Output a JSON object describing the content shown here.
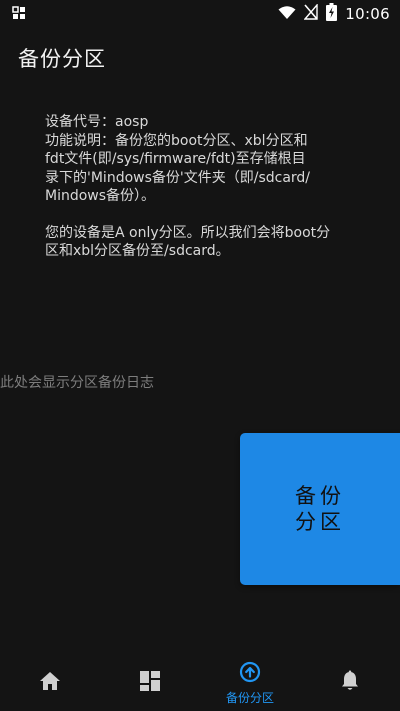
{
  "status_bar": {
    "time": "10:06",
    "icons": [
      "notification-grid-icon",
      "wifi-icon",
      "no-sim-icon",
      "battery-charging-icon"
    ]
  },
  "app_bar": {
    "title": "备份分区"
  },
  "info": {
    "lines": [
      "设备代号：aosp",
      "功能说明：备份您的boot分区、xbl分区和",
      "fdt文件(即/sys/firmware/fdt)至存储根目",
      "录下的'Mindows备份'文件夹（即/sdcard/",
      "Mindows备份）。"
    ],
    "device_lines": [
      "您的设备是A only分区。所以我们会将boot分",
      "区和xbl分区备份至/sdcard。"
    ]
  },
  "log": {
    "placeholder": "此处会显示分区备份日志"
  },
  "actions": {
    "backup_label": "备份分区"
  },
  "bottom_nav": {
    "items": [
      {
        "icon": "home-icon",
        "label": ""
      },
      {
        "icon": "dashboard-icon",
        "label": ""
      },
      {
        "icon": "upload-circle-icon",
        "label": "备份分区",
        "active": true
      },
      {
        "icon": "bell-icon",
        "label": ""
      }
    ]
  },
  "colors": {
    "background": "#141414",
    "accent": "#1e88e5",
    "nav_active": "#2196f3",
    "nav_inactive": "#cfcfcf"
  }
}
